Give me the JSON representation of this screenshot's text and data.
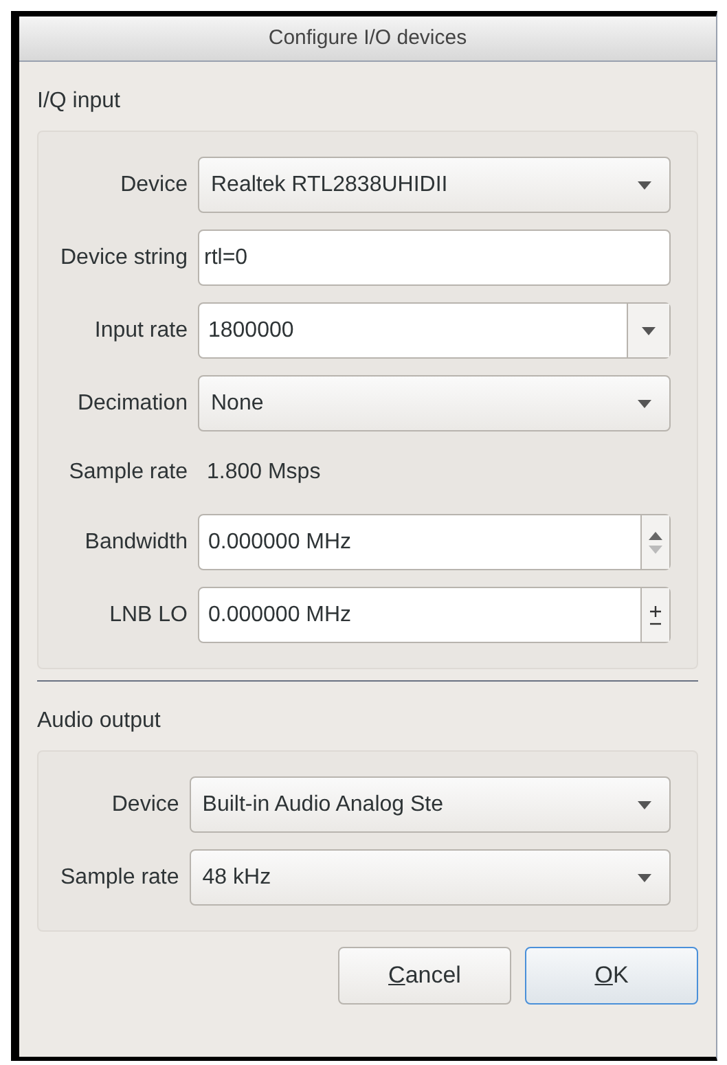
{
  "window": {
    "title": "Configure I/O devices"
  },
  "groups": [
    {
      "title": "I/Q input",
      "rows": [
        {
          "label": "Device",
          "kind": "combo",
          "value": "Realtek RTL2838UHIDII"
        },
        {
          "label": "Device string",
          "kind": "text",
          "value": "rtl=0"
        },
        {
          "label": "Input rate",
          "kind": "editable_combo",
          "value": "1800000"
        },
        {
          "label": "Decimation",
          "kind": "combo",
          "value": "None"
        },
        {
          "label": "Sample rate",
          "kind": "readout",
          "value": "1.800 Msps"
        },
        {
          "label": "Bandwidth",
          "kind": "spin_arrows",
          "value": "0.000000 MHz"
        },
        {
          "label": "LNB LO",
          "kind": "spin_plusminus",
          "value": "0.000000 MHz"
        }
      ]
    },
    {
      "title": "Audio output",
      "rows": [
        {
          "label": "Device",
          "kind": "combo",
          "value": "Built-in Audio Analog Ste"
        },
        {
          "label": "Sample rate",
          "kind": "combo",
          "value": "48 kHz"
        }
      ]
    }
  ],
  "buttons": [
    {
      "label": "Cancel",
      "default": false,
      "underline_first": true
    },
    {
      "label": "OK",
      "default": true,
      "underline_first": true
    }
  ]
}
